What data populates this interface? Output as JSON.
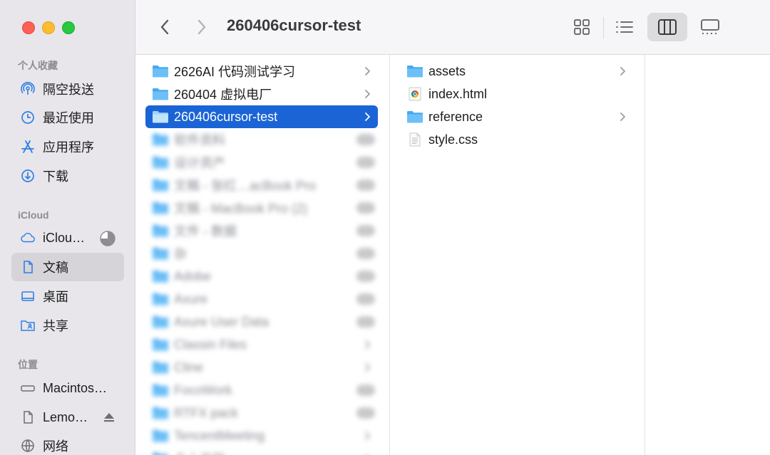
{
  "window": {
    "title": "260406cursor-test"
  },
  "sidebar": {
    "sections": [
      {
        "label": "个人收藏"
      },
      {
        "label": "iCloud"
      },
      {
        "label": "位置"
      }
    ],
    "favorites": [
      {
        "label": "隔空投送",
        "icon": "airdrop-icon"
      },
      {
        "label": "最近使用",
        "icon": "clock-icon"
      },
      {
        "label": "应用程序",
        "icon": "applications-icon"
      },
      {
        "label": "下载",
        "icon": "download-icon"
      }
    ],
    "icloud": [
      {
        "label": "iClou…",
        "icon": "icloud-icon"
      },
      {
        "label": "文稿",
        "icon": "document-icon",
        "active": true
      },
      {
        "label": "桌面",
        "icon": "desktop-icon"
      },
      {
        "label": "共享",
        "icon": "shared-folder-icon"
      }
    ],
    "locations": [
      {
        "label": "Macintos…",
        "icon": "hard-drive-icon"
      },
      {
        "label": "Lemo…",
        "icon": "document-icon"
      },
      {
        "label": "网络",
        "icon": "network-icon"
      }
    ]
  },
  "column1": [
    {
      "label": "2626AI 代码测试学习",
      "type": "folder",
      "chevron": true
    },
    {
      "label": "260404 虚拟电厂",
      "type": "folder",
      "chevron": true
    },
    {
      "label": "260406cursor-test",
      "type": "folder",
      "chevron": true,
      "selected": true
    },
    {
      "label": "软件资料",
      "type": "folder",
      "blurred": true,
      "cloud": true
    },
    {
      "label": "设计资产",
      "type": "folder",
      "blurred": true,
      "cloud": true
    },
    {
      "label": "文稿 - 张红…acBook Pro",
      "type": "folder",
      "blurred": true,
      "cloud": true
    },
    {
      "label": "文稿 - MacBook Pro (2)",
      "type": "folder",
      "blurred": true,
      "cloud": true
    },
    {
      "label": "文件 - 数据",
      "type": "folder",
      "blurred": true,
      "cloud": true
    },
    {
      "label": "杂",
      "type": "folder",
      "blurred": true,
      "cloud": true
    },
    {
      "label": "Adobe",
      "type": "folder",
      "blurred": true,
      "cloud": true
    },
    {
      "label": "Axure",
      "type": "folder",
      "blurred": true,
      "cloud": true
    },
    {
      "label": "Axure User Data",
      "type": "folder",
      "blurred": true,
      "cloud": true
    },
    {
      "label": "Classin Files",
      "type": "folder",
      "blurred": true
    },
    {
      "label": "Cline",
      "type": "folder",
      "blurred": true
    },
    {
      "label": "FocoWork",
      "type": "folder",
      "blurred": true,
      "cloud": true
    },
    {
      "label": "RTFX pack",
      "type": "folder",
      "blurred": true,
      "cloud": true
    },
    {
      "label": "TencentMeeting",
      "type": "folder",
      "blurred": true
    },
    {
      "label": "个人文档",
      "type": "folder",
      "blurred": true
    }
  ],
  "column2": [
    {
      "label": "assets",
      "type": "folder",
      "chevron": true
    },
    {
      "label": "index.html",
      "type": "html",
      "chevron": false
    },
    {
      "label": "reference",
      "type": "folder",
      "chevron": true
    },
    {
      "label": "style.css",
      "type": "css",
      "chevron": false
    }
  ],
  "colors": {
    "selection": "#1a64d6",
    "folder": "#55b5f2",
    "sidebar_bg": "#e8e6ea"
  }
}
